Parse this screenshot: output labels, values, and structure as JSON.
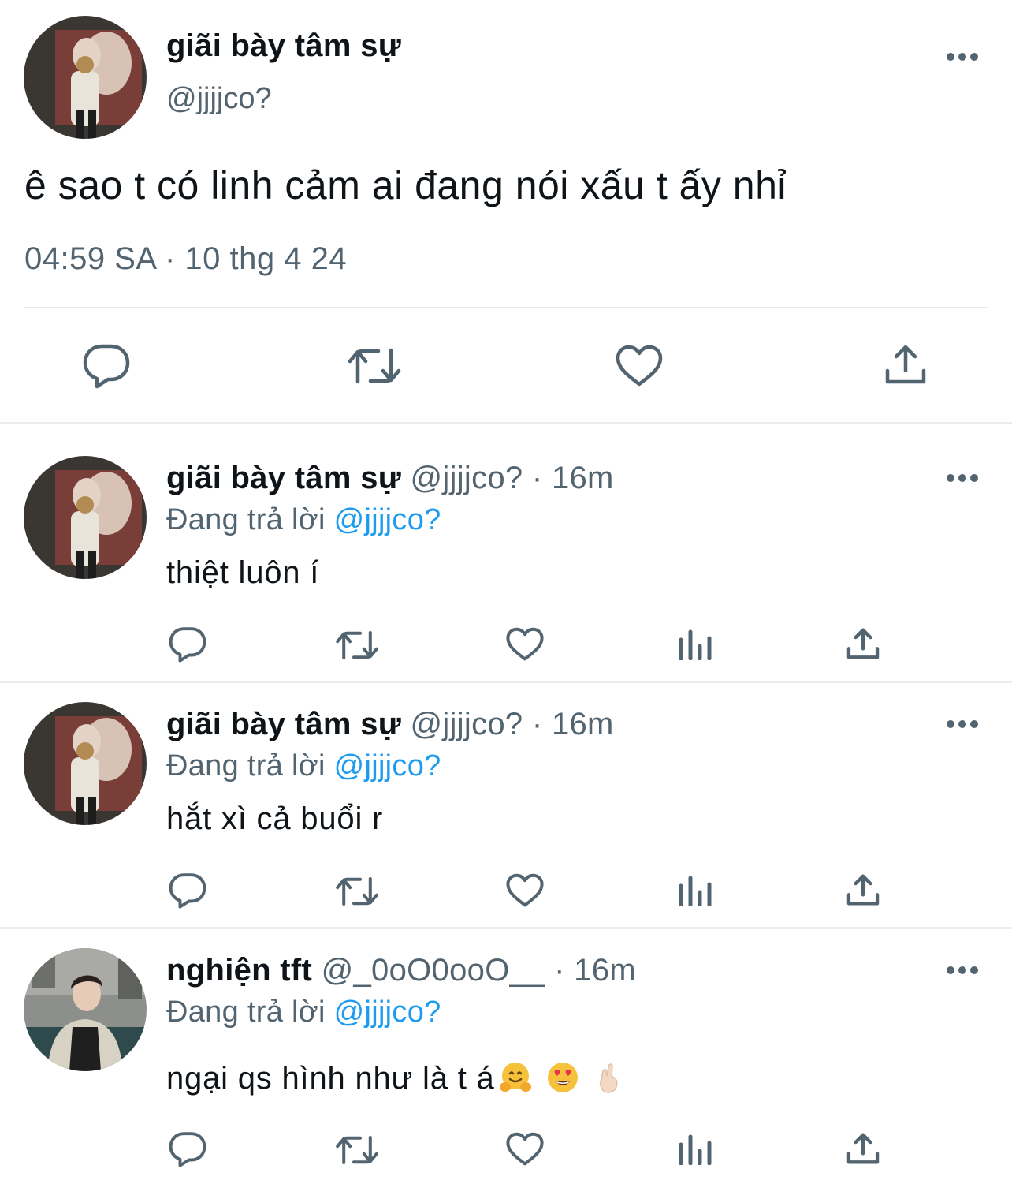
{
  "main_tweet": {
    "display_name": "giãi bày tâm sự",
    "handle": "@jjjjco?",
    "text": "ê sao t có linh cảm ai đang nói xấu t ấy nhỉ",
    "timestamp": "04:59 SA · 10 thg 4 24",
    "actions": [
      "reply-icon",
      "retweet-icon",
      "like-icon",
      "share-icon"
    ]
  },
  "replies": [
    {
      "display_name": "giãi bày tâm sự",
      "handle": "@jjjjco?",
      "separator": "·",
      "time": "16m",
      "replying_label": "Đang trả lời",
      "replying_to": "@jjjjco?",
      "text": "thiệt luôn í",
      "emojis": []
    },
    {
      "display_name": "giãi bày tâm sự",
      "handle": "@jjjjco?",
      "separator": "·",
      "time": "16m",
      "replying_label": "Đang trả lời",
      "replying_to": "@jjjjco?",
      "text": "hắt xì cả buổi r",
      "emojis": []
    },
    {
      "display_name": "nghiện tft",
      "handle": "@_0oO0ooO__",
      "separator": "·",
      "time": "16m",
      "replying_label": "Đang trả lời",
      "replying_to": "@jjjjco?",
      "text": "ngại qs hình như là t á",
      "emojis": [
        "hugging-face-emoji",
        "heart-eyes-emoji",
        "crossed-fingers-emoji"
      ]
    }
  ],
  "colors": {
    "text": "#0f1419",
    "muted": "#536471",
    "link": "#1d9bf0",
    "divider": "#e7e9eb"
  }
}
